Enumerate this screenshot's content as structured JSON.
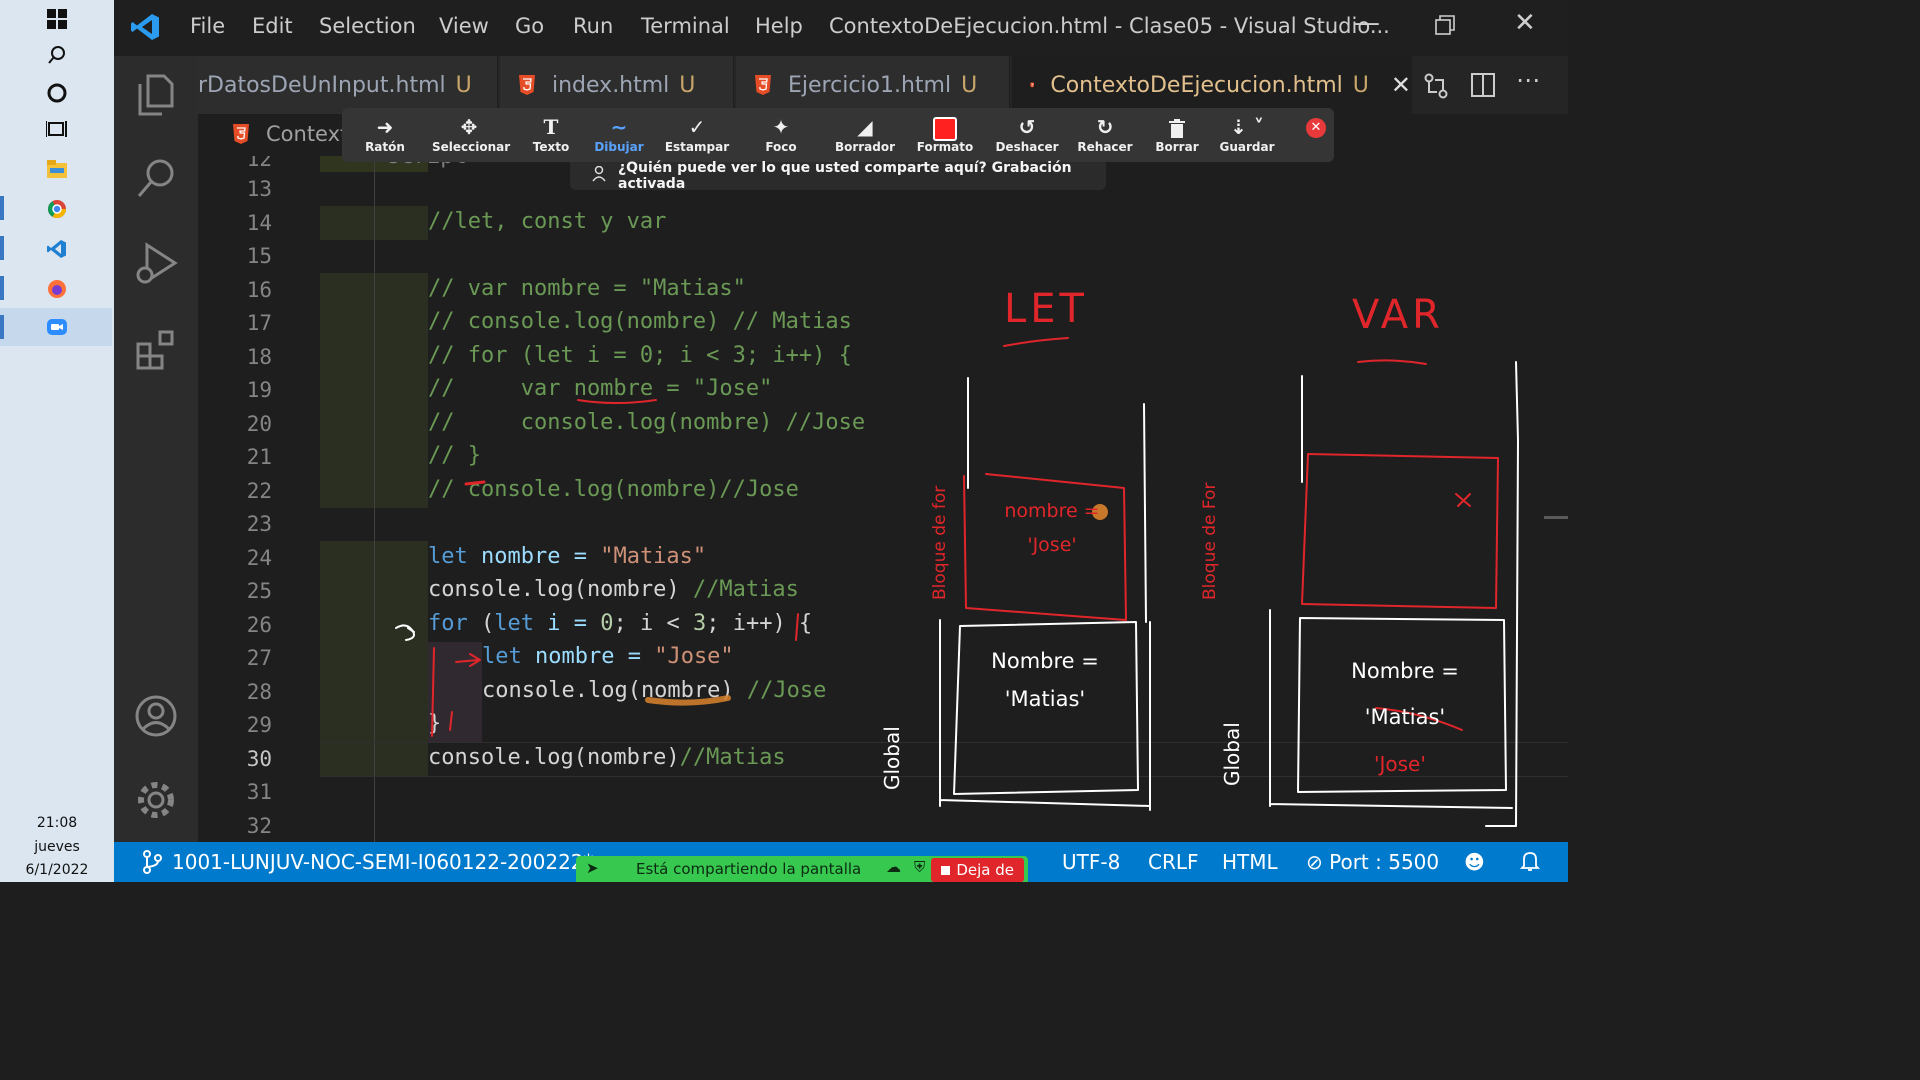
{
  "taskbar": {
    "icons": [
      "windows-start-icon",
      "search-icon",
      "cortana-icon",
      "task-view-icon",
      "file-explorer-icon",
      "chrome-icon",
      "vscode-icon",
      "firefox-icon",
      "zoom-icon"
    ],
    "time": "21:08",
    "day": "jueves",
    "date": "6/1/2022"
  },
  "titlebar": {
    "menu": [
      "File",
      "Edit",
      "Selection",
      "View",
      "Go",
      "Run",
      "Terminal",
      "Help"
    ],
    "title": "ContextoDeEjecucion.html - Clase05 - Visual Studio..."
  },
  "tabs": [
    {
      "name": "rDatosDeUnInput.html",
      "status": "U"
    },
    {
      "name": "index.html",
      "status": "U"
    },
    {
      "name": "Ejercicio1.html",
      "status": "U"
    },
    {
      "name": "ContextoDeEjecucion.html",
      "status": "U",
      "active": true
    }
  ],
  "breadcrumb": "Context",
  "annotation_toolbar": {
    "tools": [
      "Ratón",
      "Seleccionar",
      "Texto",
      "Dibujar",
      "Estampar",
      "Foco",
      "Borrador",
      "Formato",
      "Deshacer",
      "Rehacer",
      "Borrar",
      "Guardar"
    ],
    "selected": "Dibujar",
    "notice": "¿Quién puede ver lo que usted comparte aquí? Grabación activada"
  },
  "editor": {
    "line_numbers": [
      "12",
      "13",
      "14",
      "15",
      "16",
      "17",
      "18",
      "19",
      "20",
      "21",
      "22",
      "23",
      "24",
      "25",
      "26",
      "27",
      "28",
      "29",
      "30",
      "31",
      "32"
    ],
    "current_line": "30",
    "lines": {
      "l12": "<script>",
      "l14": "//let, const y var",
      "l16": "// var nombre = \"Matias\"",
      "l17": "// console.log(nombre) // Matias",
      "l18": "// for (let i = 0; i < 3; i++) {",
      "l19": "//     var nombre = \"Jose\"",
      "l20": "//     console.log(nombre) //Jose",
      "l21": "// }",
      "l22": "// console.log(nombre)//Jose",
      "l24_kw": "let",
      "l24_rest": " nombre = ",
      "l24_str": "\"Matias\"",
      "l25_code": "console.log(nombre) ",
      "l25_cm": "//Matias",
      "l26_kw": "for",
      "l26_a": " (",
      "l26_kw2": "let",
      "l26_b": " i = ",
      "l26_n1": "0",
      "l26_c": "; i < ",
      "l26_n2": "3",
      "l26_d": "; i++) {",
      "l27_kw": "let",
      "l27_rest": " nombre = ",
      "l27_str": "\"Jose\"",
      "l28_code": "console.log(nombre) ",
      "l28_cm": "//Jose",
      "l29": "}",
      "l30_code": "console.log(nombre)",
      "l30_cm": "//Matias"
    }
  },
  "drawing": {
    "let_title": "LET",
    "var_title": "VAR",
    "let_block_label": "Bloque de for",
    "let_block_text": "nombre = 'Jose'",
    "let_global_label": "Global",
    "let_global_text": "Nombre = 'Matias'",
    "var_block_label": "Bloque de For",
    "var_global_label": "Global",
    "var_global_text": "Nombre = 'Matias'",
    "var_overwrite_text": "'Jose'"
  },
  "statusbar": {
    "branch": "1001-LUNJUV-NOC-SEMI-I060122-200222*",
    "encoding": "UTF-8",
    "eol": "CRLF",
    "language": "HTML",
    "port": "Port : 5500"
  },
  "share_banner": {
    "text": "Está compartiendo la pantalla",
    "stop": "Deja de"
  },
  "colors": {
    "accent": "#007acc",
    "ink_red": "#e0262b",
    "ink_white": "#ffffff",
    "share_green": "#37c84f"
  }
}
